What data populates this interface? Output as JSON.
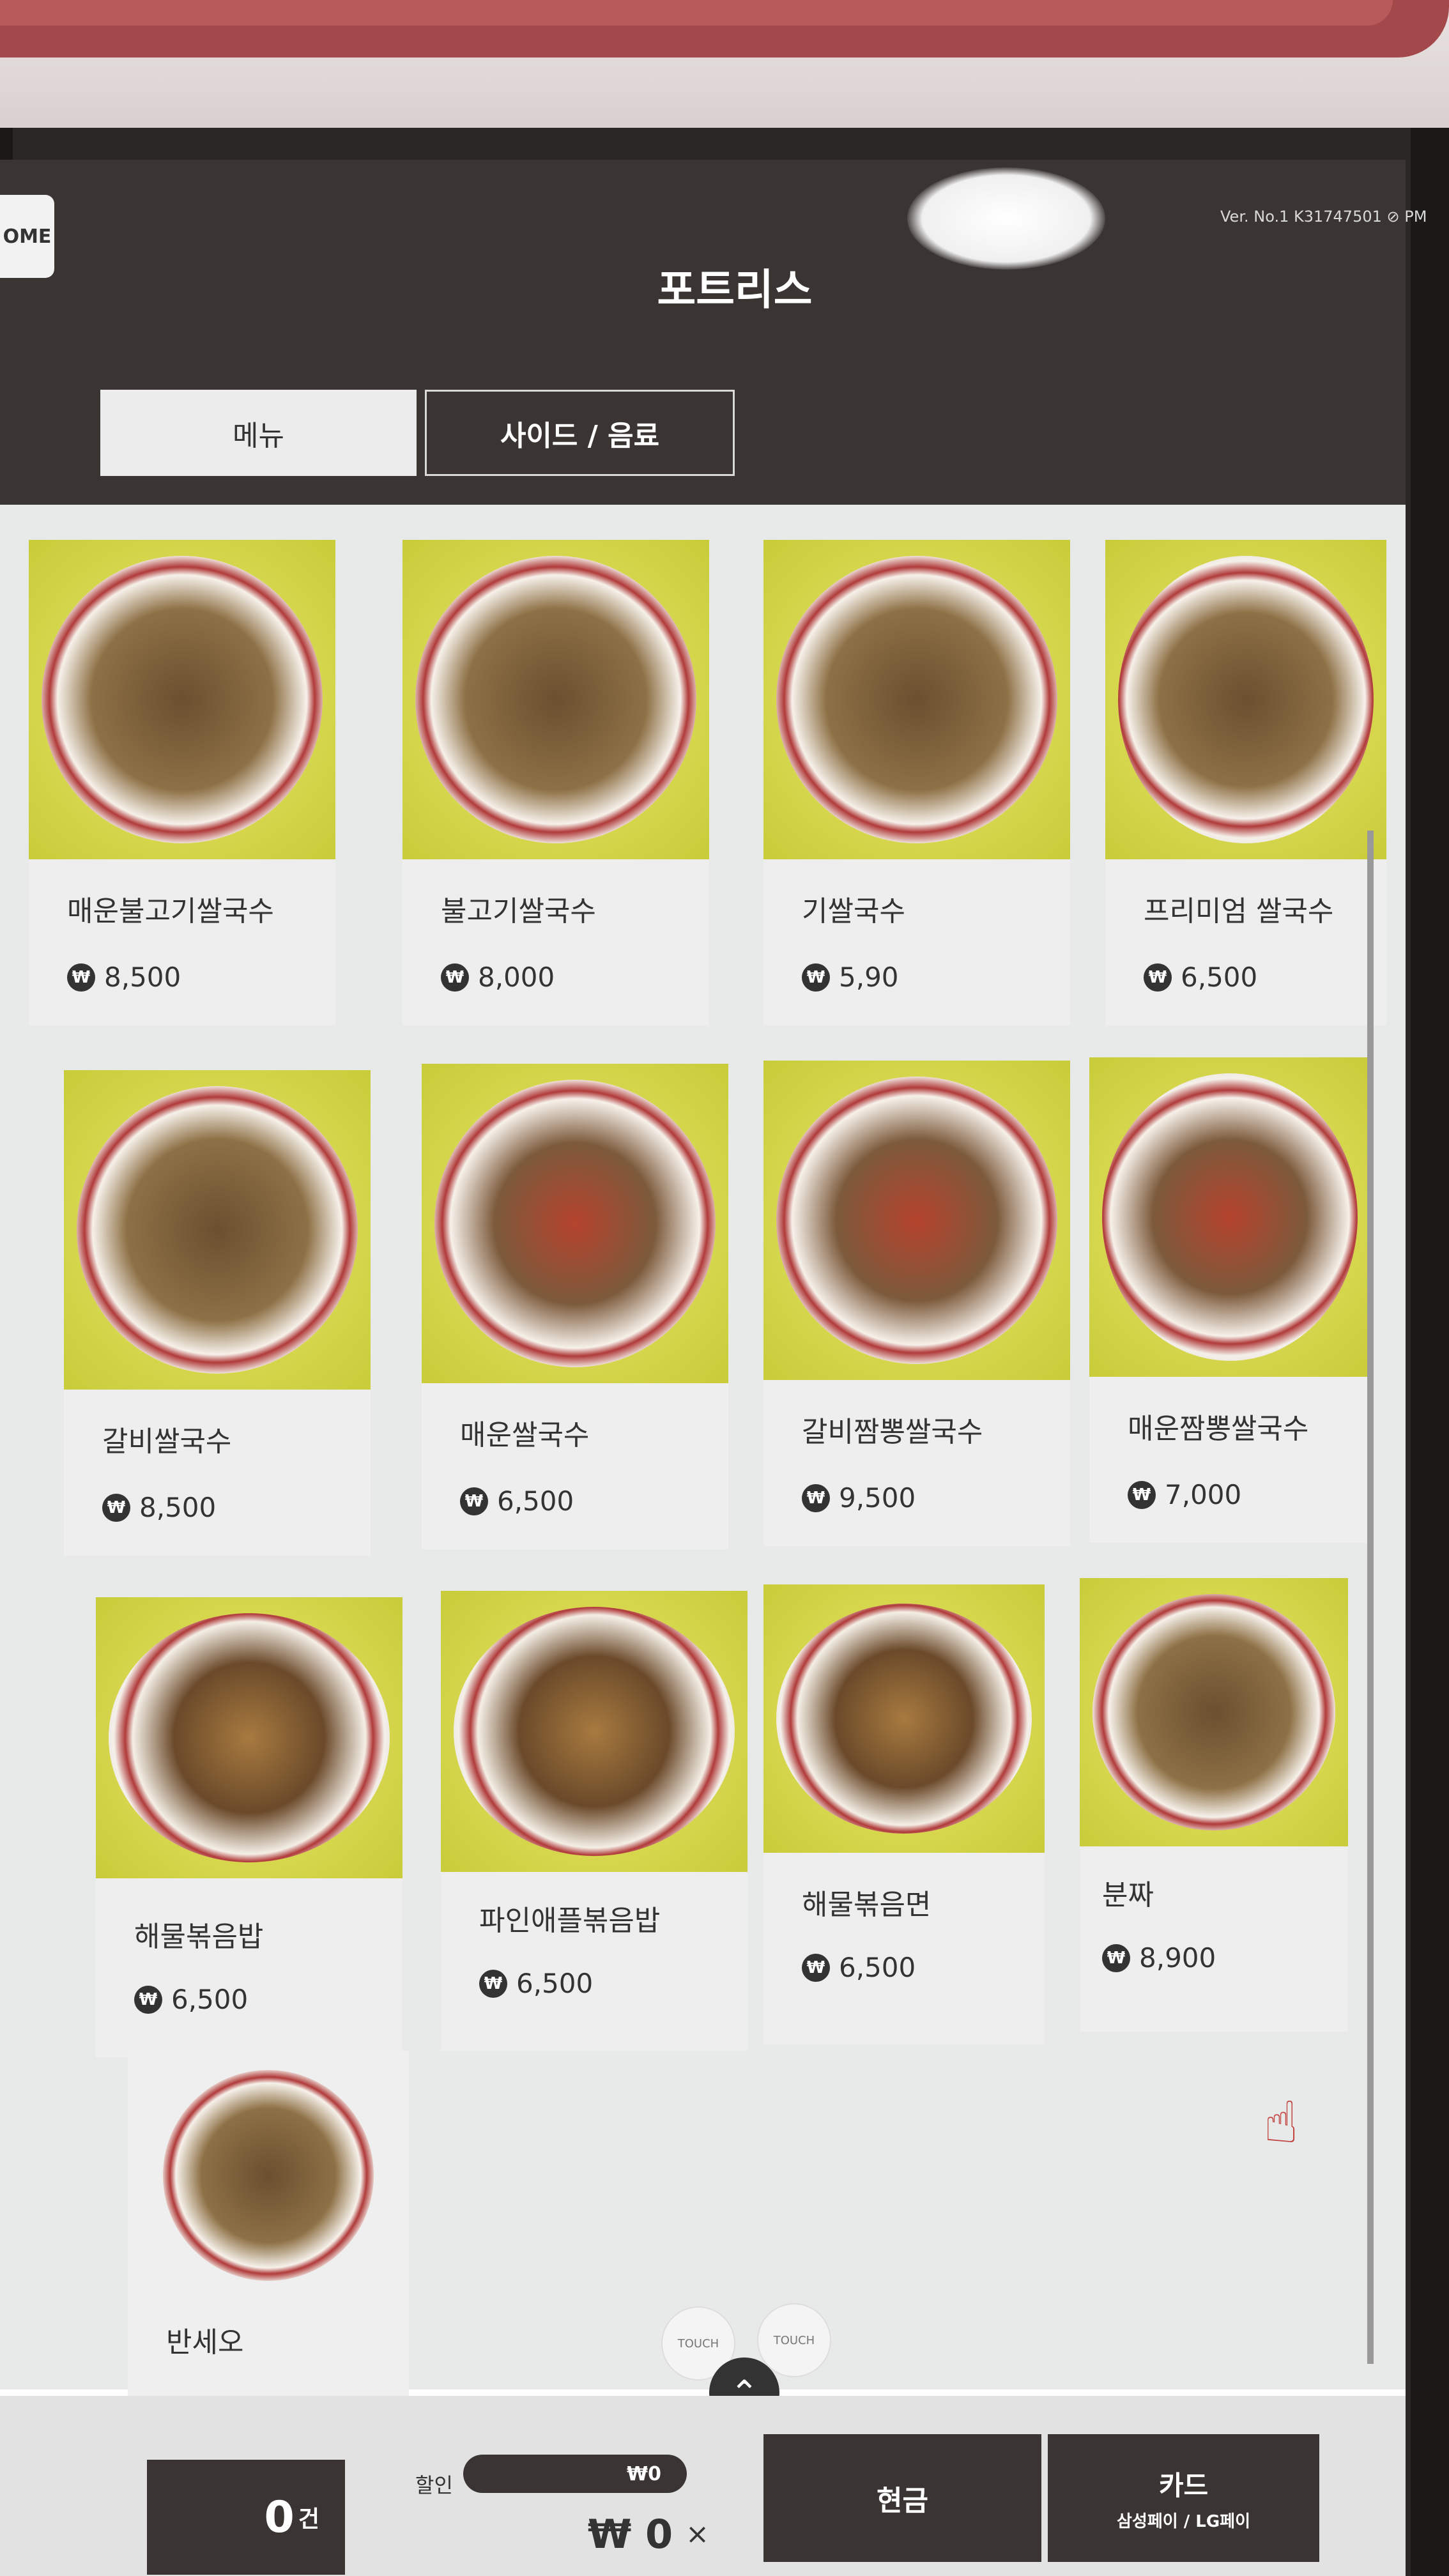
{
  "header": {
    "home_label": "OME",
    "version": "Ver.   No.1 K31747501  ⊘ PM",
    "store_title": "포트리스"
  },
  "tabs": [
    {
      "label": "메뉴"
    },
    {
      "label": "사이드 / 음료"
    }
  ],
  "menu_items": [
    {
      "name": "매운불고기쌀국수",
      "price": "8,500"
    },
    {
      "name": "불고기쌀국수",
      "price": "8,000"
    },
    {
      "name": "기쌀국수",
      "price": "5,90"
    },
    {
      "name": "프리미엄 쌀국수",
      "price": "6,500"
    },
    {
      "name": "갈비쌀국수",
      "price": "8,500"
    },
    {
      "name": "매운쌀국수",
      "price": "6,500"
    },
    {
      "name": "갈비짬뽕쌀국수",
      "price": "9,500"
    },
    {
      "name": "매운짬뽕쌀국수",
      "price": "7,000"
    },
    {
      "name": "해물볶음밥",
      "price": "6,500"
    },
    {
      "name": "파인애플볶음밥",
      "price": "6,500"
    },
    {
      "name": "해물볶음면",
      "price": "6,500"
    },
    {
      "name": "분짜",
      "price": "8,900"
    },
    {
      "name": "반세오",
      "price": ""
    }
  ],
  "currency_icon": "₩",
  "touch_label": "TOUCH",
  "footer": {
    "count": "0",
    "count_unit": "건",
    "discount_label": "할인",
    "discount_value": "₩0",
    "total": "₩ 0",
    "clear": "×",
    "cash_label": "현금",
    "card_label": "카드",
    "card_sub": "삼성페이 / LG페이"
  }
}
